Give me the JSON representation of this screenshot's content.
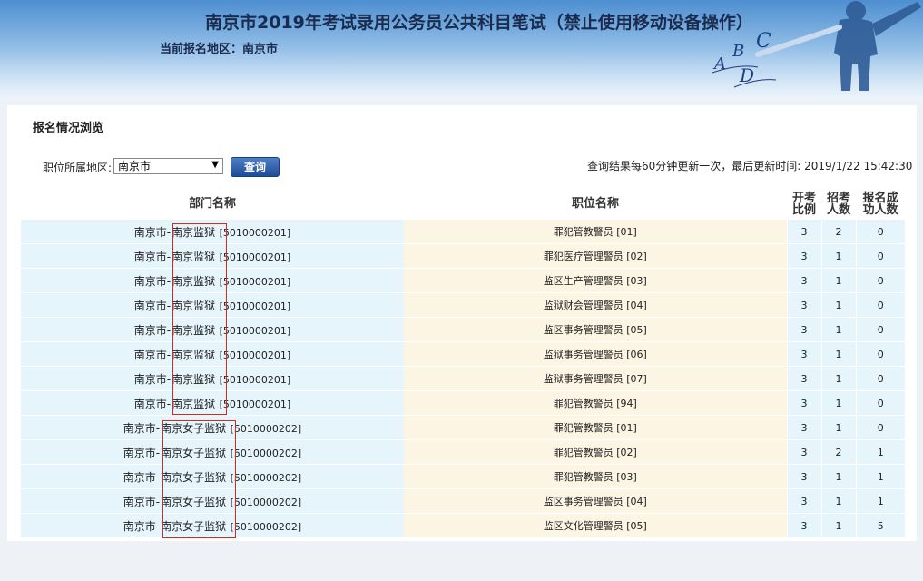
{
  "header": {
    "title": "南京市2019年考试录用公务员公共科目笔试（禁止使用移动设备操作）",
    "region_label": "当前报名地区：",
    "region_value": "南京市"
  },
  "section": {
    "title": "报名情况浏览"
  },
  "filter": {
    "label": "职位所属地区:",
    "selected": "南京市",
    "query_button": "查询",
    "update_note": "查询结果每60分钟更新一次，最后更新时间: 2019/1/22 15:42:30"
  },
  "table": {
    "headers": {
      "dept": "部门名称",
      "job": "职位名称",
      "ratio": "开考比例",
      "quota": "招考人数",
      "success": "报名成功人数"
    },
    "rows": [
      {
        "city": "南京市-",
        "org": "南京监狱",
        "code": "[5010000201]",
        "job": "罪犯管教警员 [01]",
        "ratio": "3",
        "quota": "2",
        "success": "0"
      },
      {
        "city": "南京市-",
        "org": "南京监狱",
        "code": "[5010000201]",
        "job": "罪犯医疗管理警员 [02]",
        "ratio": "3",
        "quota": "1",
        "success": "0"
      },
      {
        "city": "南京市-",
        "org": "南京监狱",
        "code": "[5010000201]",
        "job": "监区生产管理警员 [03]",
        "ratio": "3",
        "quota": "1",
        "success": "0"
      },
      {
        "city": "南京市-",
        "org": "南京监狱",
        "code": "[5010000201]",
        "job": "监狱财会管理警员 [04]",
        "ratio": "3",
        "quota": "1",
        "success": "0"
      },
      {
        "city": "南京市-",
        "org": "南京监狱",
        "code": "[5010000201]",
        "job": "监区事务管理警员 [05]",
        "ratio": "3",
        "quota": "1",
        "success": "0"
      },
      {
        "city": "南京市-",
        "org": "南京监狱",
        "code": "[5010000201]",
        "job": "监狱事务管理警员 [06]",
        "ratio": "3",
        "quota": "1",
        "success": "0"
      },
      {
        "city": "南京市-",
        "org": "南京监狱",
        "code": "[5010000201]",
        "job": "监狱事务管理警员 [07]",
        "ratio": "3",
        "quota": "1",
        "success": "0"
      },
      {
        "city": "南京市-",
        "org": "南京监狱",
        "code": "[5010000201]",
        "job": "罪犯管教警员 [94]",
        "ratio": "3",
        "quota": "1",
        "success": "0"
      },
      {
        "city": "南京市-",
        "org": "南京女子监狱",
        "code": "[5010000202]",
        "job": "罪犯管教警员 [01]",
        "ratio": "3",
        "quota": "1",
        "success": "0"
      },
      {
        "city": "南京市-",
        "org": "南京女子监狱",
        "code": "[5010000202]",
        "job": "罪犯管教警员 [02]",
        "ratio": "3",
        "quota": "2",
        "success": "1"
      },
      {
        "city": "南京市-",
        "org": "南京女子监狱",
        "code": "[5010000202]",
        "job": "罪犯管教警员 [03]",
        "ratio": "3",
        "quota": "1",
        "success": "1"
      },
      {
        "city": "南京市-",
        "org": "南京女子监狱",
        "code": "[5010000202]",
        "job": "监区事务管理警员 [04]",
        "ratio": "3",
        "quota": "1",
        "success": "1"
      },
      {
        "city": "南京市-",
        "org": "南京女子监狱",
        "code": "[5010000202]",
        "job": "监区文化管理警员 [05]",
        "ratio": "3",
        "quota": "1",
        "success": "5"
      }
    ]
  },
  "art": {
    "letters": [
      "A",
      "B",
      "C",
      "D"
    ]
  },
  "colors": {
    "header_top": "#4d8fd0",
    "dept_cell": "#e6f4fb",
    "job_cell": "#fdf5e4",
    "query_button": "#1c4c96",
    "annotation_red": "#d9281c"
  }
}
